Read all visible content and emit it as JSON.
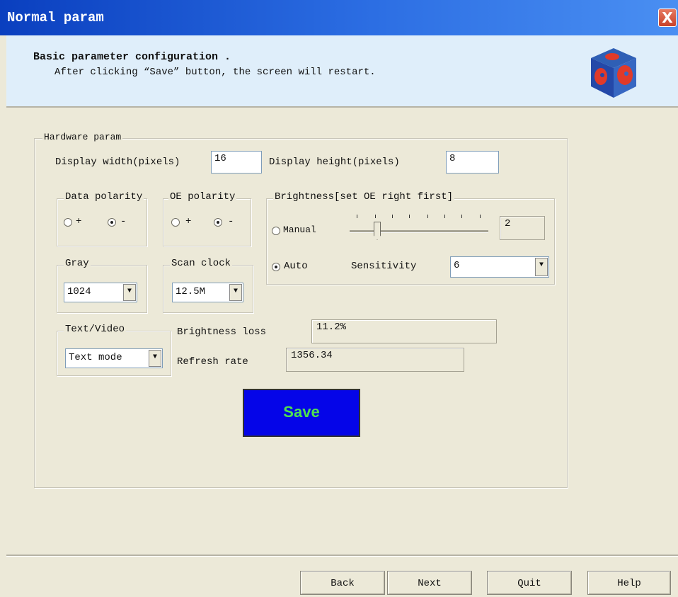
{
  "window": {
    "title": "Normal param",
    "close_label": "X"
  },
  "header": {
    "title": "Basic parameter configuration .",
    "subtitle": "After clicking “Save” button, the screen will restart."
  },
  "hardware": {
    "group_label": "Hardware param",
    "width_label": "Display width(pixels)",
    "width_value": "16",
    "height_label": "Display height(pixels)",
    "height_value": "8"
  },
  "data_polarity": {
    "label": "Data polarity",
    "plus": "+",
    "minus": "-",
    "selected": "minus"
  },
  "oe_polarity": {
    "label": "OE polarity",
    "plus": "+",
    "minus": "-",
    "selected": "minus"
  },
  "brightness": {
    "label": "Brightness[set OE right first]",
    "manual_label": "Manual",
    "auto_label": "Auto",
    "mode": "auto",
    "slider_value": "2",
    "sensitivity_label": "Sensitivity",
    "sensitivity_value": "6"
  },
  "gray": {
    "label": "Gray",
    "value": "1024"
  },
  "scan_clock": {
    "label": "Scan clock",
    "value": "12.5M"
  },
  "text_video": {
    "label": "Text/Video",
    "value": "Text mode"
  },
  "stats": {
    "brightness_loss_label": "Brightness loss",
    "brightness_loss_value": "11.2%",
    "refresh_rate_label": "Refresh rate",
    "refresh_rate_value": "1356.34"
  },
  "save_label": "Save",
  "footer": {
    "back": "Back",
    "next": "Next",
    "quit": "Quit",
    "help": "Help"
  }
}
